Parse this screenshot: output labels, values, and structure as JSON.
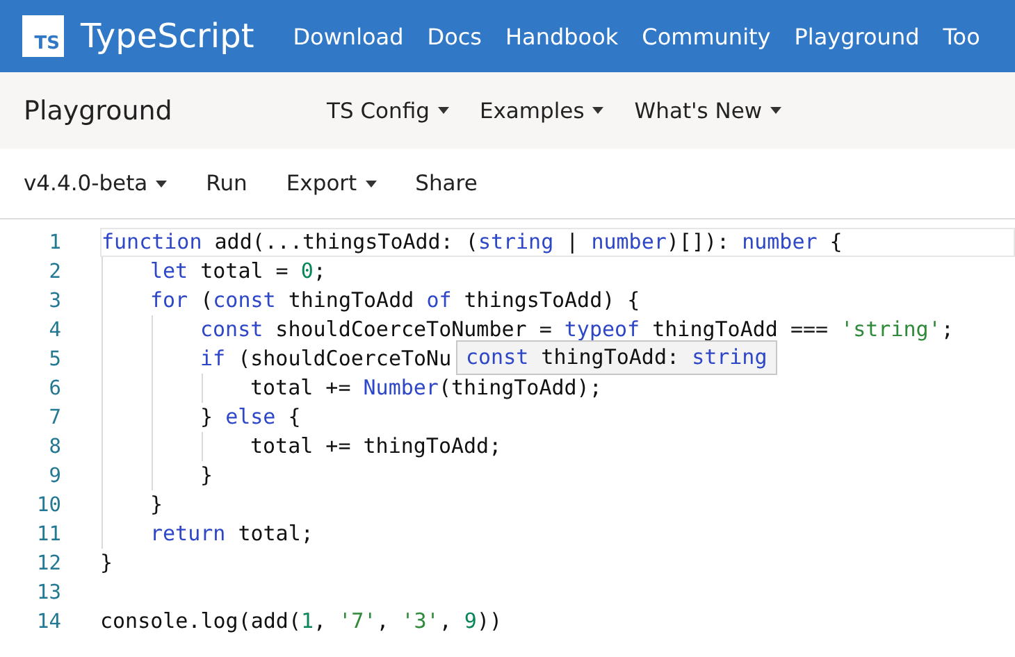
{
  "header": {
    "logo": "TS",
    "brand": "TypeScript",
    "nav": [
      "Download",
      "Docs",
      "Handbook",
      "Community",
      "Playground",
      "Too"
    ]
  },
  "subheader": {
    "title": "Playground",
    "menus": [
      "TS Config",
      "Examples",
      "What's New"
    ]
  },
  "toolbar": [
    {
      "label": "v4.4.0-beta",
      "dropdown": true
    },
    {
      "label": "Run",
      "dropdown": false
    },
    {
      "label": "Export",
      "dropdown": true
    },
    {
      "label": "Share",
      "dropdown": false
    }
  ],
  "editor": {
    "lines": [
      {
        "number": "1",
        "current": true,
        "tokens": [
          {
            "t": "function",
            "kind": "keyword"
          },
          {
            "t": " add(...thingsToAdd: (",
            "kind": "plain"
          },
          {
            "t": "string",
            "kind": "keyword"
          },
          {
            "t": " | ",
            "kind": "plain"
          },
          {
            "t": "number",
            "kind": "keyword"
          },
          {
            "t": ")[]): ",
            "kind": "plain"
          },
          {
            "t": "number",
            "kind": "keyword"
          },
          {
            "t": " {",
            "kind": "plain"
          }
        ],
        "children": [
          {
            "number": "2",
            "current": false,
            "tokens": [
              {
                "t": "let",
                "kind": "keyword"
              },
              {
                "t": " total = ",
                "kind": "plain"
              },
              {
                "t": "0",
                "kind": "number"
              },
              {
                "t": ";",
                "kind": "plain"
              }
            ]
          },
          {
            "number": "3",
            "current": false,
            "tokens": [
              {
                "t": "for",
                "kind": "keyword"
              },
              {
                "t": " (",
                "kind": "plain"
              },
              {
                "t": "const",
                "kind": "keyword"
              },
              {
                "t": " thingToAdd ",
                "kind": "plain"
              },
              {
                "t": "of",
                "kind": "keyword"
              },
              {
                "t": " thingsToAdd) {",
                "kind": "plain"
              }
            ],
            "children": [
              {
                "number": "4",
                "current": false,
                "tokens": [
                  {
                    "t": "const",
                    "kind": "keyword"
                  },
                  {
                    "t": " shouldCoerceToNumber = ",
                    "kind": "plain"
                  },
                  {
                    "t": "typeof",
                    "kind": "keyword"
                  },
                  {
                    "t": " thingToAdd === ",
                    "kind": "plain"
                  },
                  {
                    "t": "'string'",
                    "kind": "string"
                  },
                  {
                    "t": ";",
                    "kind": "plain"
                  }
                ]
              },
              {
                "number": "5",
                "current": false,
                "tokens": [
                  {
                    "t": "if",
                    "kind": "keyword"
                  },
                  {
                    "t": " (shouldCoerceToNu",
                    "kind": "plain"
                  }
                ],
                "children": [
                  {
                    "number": "6",
                    "current": false,
                    "tokens": [
                      {
                        "t": "total += ",
                        "kind": "plain"
                      },
                      {
                        "t": "Number",
                        "kind": "keyword"
                      },
                      {
                        "t": "(thingToAdd);",
                        "kind": "plain"
                      }
                    ]
                  }
                ]
              },
              {
                "number": "7",
                "current": false,
                "tokens": [
                  {
                    "t": "} ",
                    "kind": "plain"
                  },
                  {
                    "t": "else",
                    "kind": "keyword"
                  },
                  {
                    "t": " {",
                    "kind": "plain"
                  }
                ],
                "children": [
                  {
                    "number": "8",
                    "current": false,
                    "tokens": [
                      {
                        "t": "total += thingToAdd;",
                        "kind": "plain"
                      }
                    ]
                  }
                ]
              },
              {
                "number": "9",
                "current": false,
                "tokens": [
                  {
                    "t": "}",
                    "kind": "plain"
                  }
                ]
              }
            ]
          },
          {
            "number": "10",
            "current": false,
            "tokens": [
              {
                "t": "}",
                "kind": "plain"
              }
            ]
          },
          {
            "number": "11",
            "current": false,
            "tokens": [
              {
                "t": "return",
                "kind": "keyword"
              },
              {
                "t": " total;",
                "kind": "plain"
              }
            ]
          }
        ]
      },
      {
        "number": "12",
        "current": false,
        "tokens": [
          {
            "t": "}",
            "kind": "plain"
          }
        ]
      },
      {
        "number": "13",
        "current": false
      },
      {
        "number": "14",
        "current": false,
        "tokens": [
          {
            "t": "console.log(add(",
            "kind": "plain"
          },
          {
            "t": "1",
            "kind": "number"
          },
          {
            "t": ", ",
            "kind": "plain"
          },
          {
            "t": "'7'",
            "kind": "string"
          },
          {
            "t": ", ",
            "kind": "plain"
          },
          {
            "t": "'3'",
            "kind": "string"
          },
          {
            "t": ", ",
            "kind": "plain"
          },
          {
            "t": "9",
            "kind": "number"
          },
          {
            "t": "))",
            "kind": "plain"
          }
        ]
      }
    ],
    "tooltip": {
      "tokens": [
        {
          "t": "const",
          "kind": "keyword"
        },
        {
          "t": " thingToAdd: ",
          "kind": "plain"
        },
        {
          "t": "string",
          "kind": "keyword"
        }
      ]
    }
  }
}
